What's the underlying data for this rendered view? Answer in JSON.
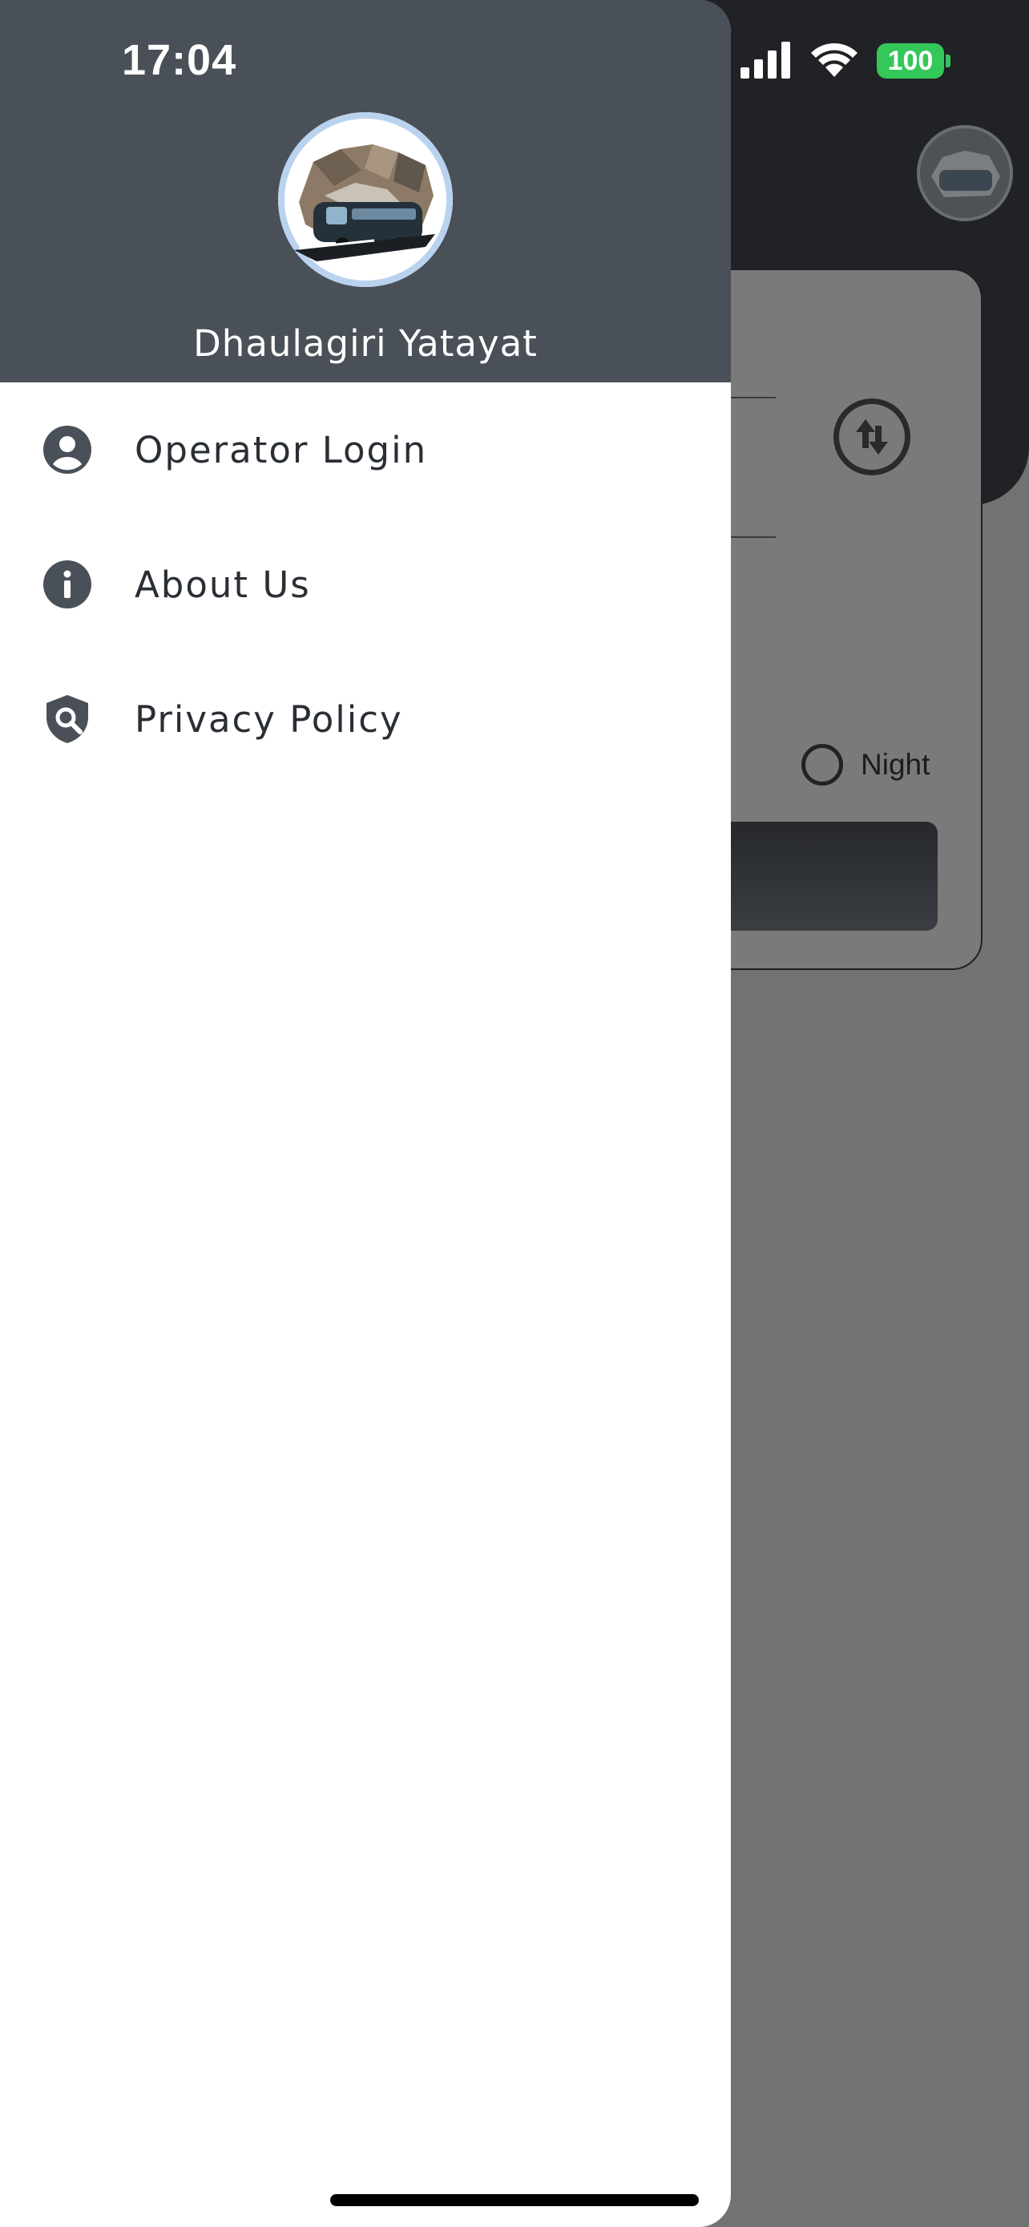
{
  "status_bar": {
    "time": "17:04",
    "battery": "100",
    "icons": [
      "cellular-signal-icon",
      "wifi-icon",
      "battery-icon"
    ]
  },
  "drawer": {
    "brand_name": "Dhaulagiri Yatayat",
    "logo_icon": "bus-mountain-logo",
    "menu": [
      {
        "label": "Operator Login",
        "icon": "account-circle-icon"
      },
      {
        "label": "About Us",
        "icon": "info-icon"
      },
      {
        "label": "Privacy Policy",
        "icon": "privacy-shield-icon"
      }
    ]
  },
  "background_screen": {
    "shift_option_label": "Night"
  },
  "colors": {
    "drawer_header": "#4a5058",
    "scrim": "#727272",
    "battery": "#34c759",
    "text": "#2a2f36"
  }
}
